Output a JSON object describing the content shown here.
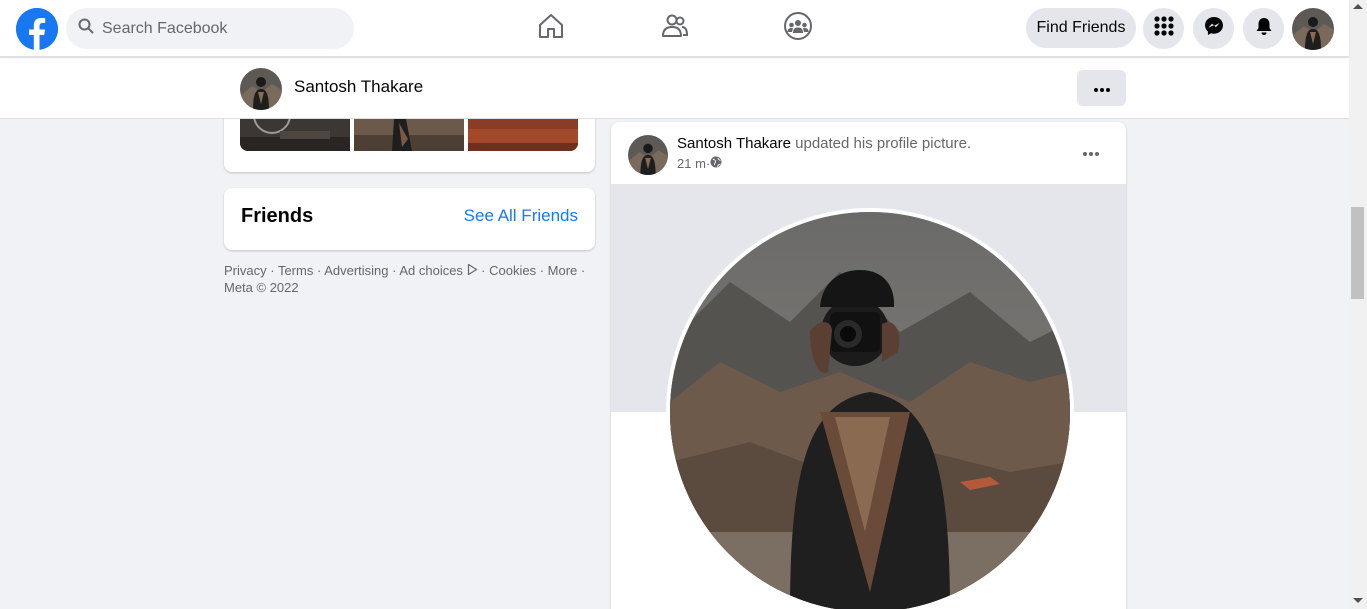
{
  "topbar": {
    "search_placeholder": "Search Facebook",
    "find_friends_label": "Find Friends",
    "icons": [
      "facebook-logo-icon",
      "search-icon",
      "home-icon",
      "friends-icon",
      "groups-icon",
      "menu-grid-icon",
      "messenger-icon",
      "notifications-icon"
    ]
  },
  "profile_bar": {
    "name": "Santosh Thakare"
  },
  "friends_card": {
    "title": "Friends",
    "see_all_label": "See All Friends"
  },
  "footer": {
    "links": [
      "Privacy",
      "Terms",
      "Advertising",
      "Ad choices",
      "Cookies",
      "More"
    ],
    "separator": " · ",
    "copyright": "Meta © 2022"
  },
  "post": {
    "author": "Santosh Thakare",
    "action": " updated his profile picture.",
    "time": "21 m",
    "dot": " · "
  },
  "colors": {
    "brand": "#1877f2",
    "background": "#f0f2f5",
    "button_gray": "#e4e6eb",
    "secondary_text": "#65676b"
  }
}
